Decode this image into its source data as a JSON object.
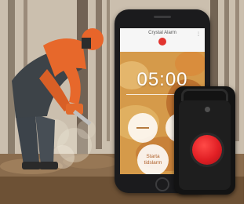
{
  "app": {
    "title": "Crystal Alarm",
    "menu_glyph": "⋮",
    "timer": "05:00",
    "minus_glyph": "",
    "start_label_line1": "Starta",
    "start_label_line2": "tidslarm"
  },
  "colors": {
    "alarm_red": "#e2342f",
    "screen_accent": "#c98a3a",
    "device_body": "#131313"
  },
  "icons": {
    "badge": "alarm-badge-icon",
    "menu": "menu-dots-icon"
  }
}
